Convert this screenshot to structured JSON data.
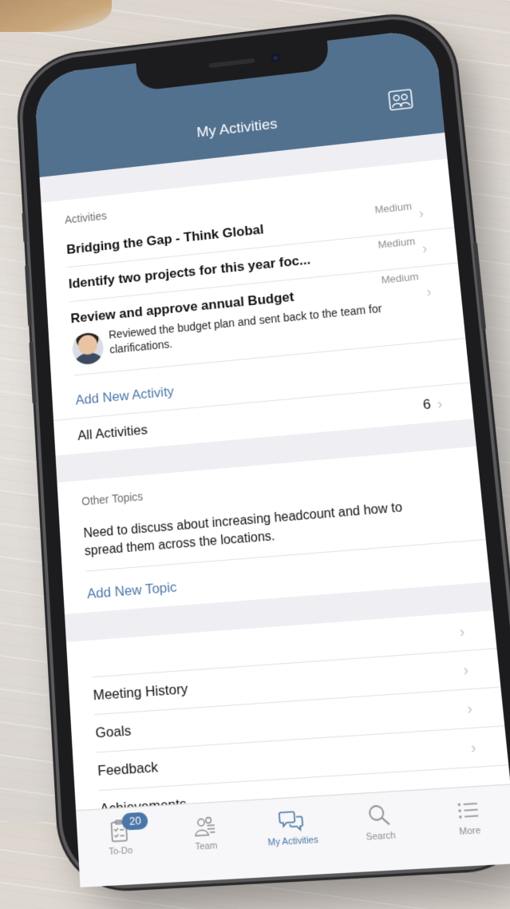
{
  "header": {
    "title": "My Activities",
    "team_icon": "team-icon"
  },
  "activities": {
    "section_label": "Activities",
    "items": [
      {
        "title": "Bridging the Gap - Think Global",
        "priority": "Medium"
      },
      {
        "title": "Identify two projects for this year foc...",
        "priority": "Medium"
      },
      {
        "title": "Review and approve annual Budget",
        "priority": "Medium",
        "comment": "Reviewed the budget plan and sent back to the team for clarifications."
      }
    ],
    "add_label": "Add New Activity",
    "all_label": "All Activities",
    "all_count": "6"
  },
  "topics": {
    "section_label": "Other Topics",
    "items": [
      {
        "text": "Need to discuss about increasing headcount and how to spread them across the locations."
      }
    ],
    "add_label": "Add New Topic"
  },
  "more_links": {
    "items": [
      {
        "label": ""
      },
      {
        "label": "Meeting History"
      },
      {
        "label": "Goals"
      },
      {
        "label": "Feedback"
      },
      {
        "label": "Achievements"
      }
    ]
  },
  "tabbar": {
    "items": [
      {
        "label": "To-Do",
        "icon": "clipboard-icon",
        "badge": "20"
      },
      {
        "label": "Team",
        "icon": "team-icon"
      },
      {
        "label": "My Activities",
        "icon": "chat-bubbles-icon",
        "active": true
      },
      {
        "label": "Search",
        "icon": "search-icon"
      },
      {
        "label": "More",
        "icon": "list-icon"
      }
    ]
  },
  "colors": {
    "navbar": "#52718f",
    "accent": "#4b77a8",
    "background": "#efeef3"
  }
}
